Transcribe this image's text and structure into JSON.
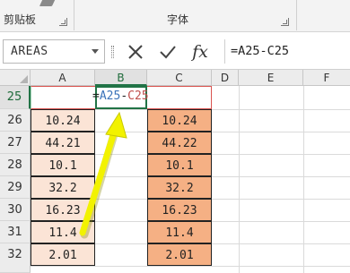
{
  "ribbon": {
    "clipboard_label": "剪贴板",
    "font_label": "字体"
  },
  "formula_bar": {
    "name_box_value": "AREAS",
    "cancel_icon": "close-icon",
    "enter_icon": "check-icon",
    "fx_label": "fx",
    "formula_value": "=A25-C25"
  },
  "grid": {
    "columns": [
      "A",
      "B",
      "C",
      "D",
      "E",
      "F"
    ],
    "active_column": "B",
    "rows": [
      "25",
      "26",
      "27",
      "28",
      "29",
      "30",
      "31",
      "32"
    ],
    "active_row": "25",
    "edit": {
      "eq": "=",
      "ref1": "A25",
      "op": "-",
      "ref2": "C25"
    },
    "col_a_values": [
      "10.24",
      "44.21",
      "10.1",
      "32.2",
      "16.23",
      "11.4",
      "2.01"
    ],
    "col_c_values": [
      "10.24",
      "44.22",
      "10.1",
      "32.2",
      "16.23",
      "11.4",
      "2.01"
    ]
  },
  "colors": {
    "col_a_fill": "#fbe4d6",
    "col_c_fill": "#f5b084",
    "ref1_color": "#3b73b9",
    "ref2_color": "#c0504d",
    "annotation_arrow": "#f2f200",
    "selection_green": "#217346"
  },
  "annotation": {
    "icon": "yellow-arrow-icon"
  }
}
